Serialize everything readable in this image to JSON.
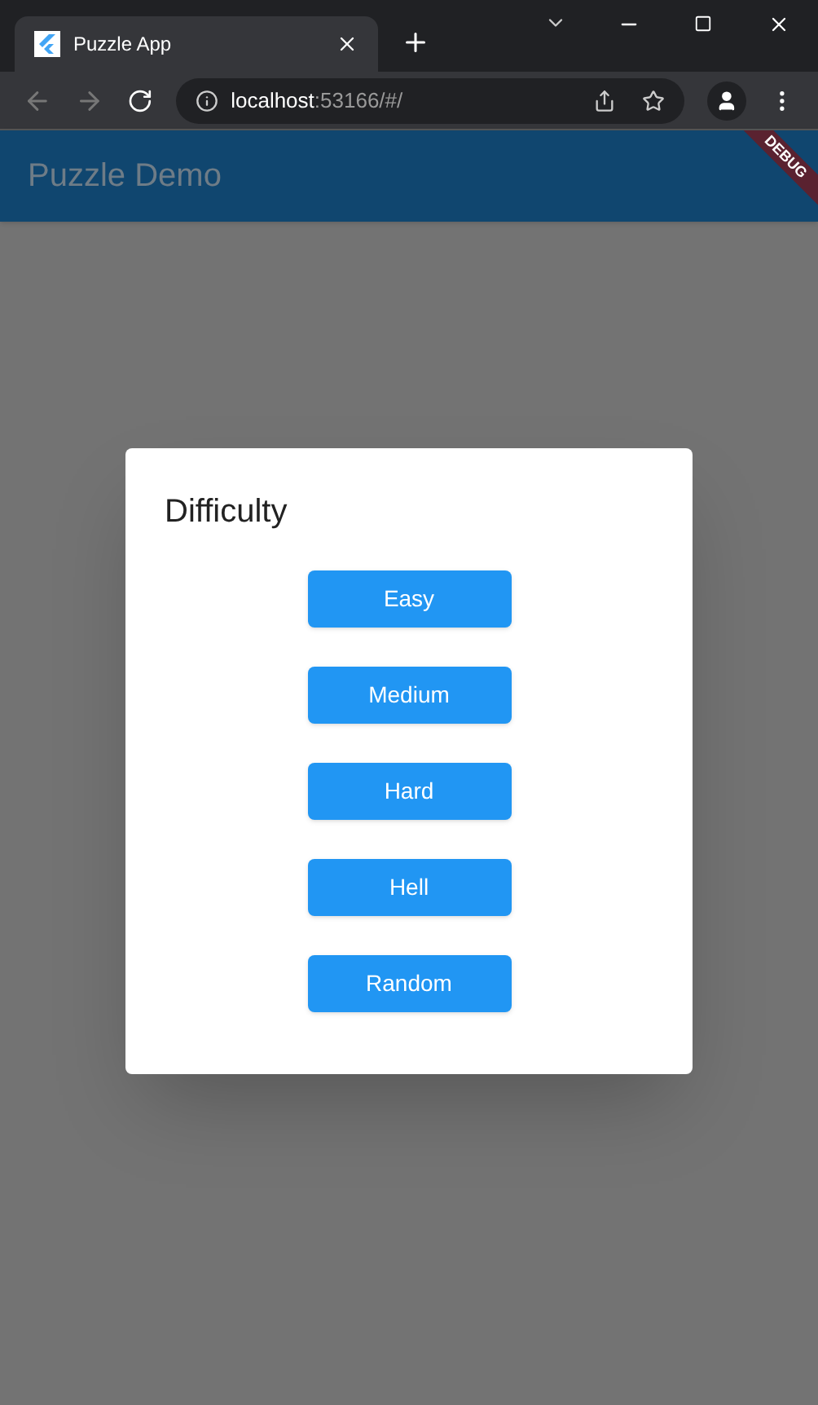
{
  "browser": {
    "tab_title": "Puzzle App",
    "url_host": "localhost",
    "url_rest": ":53166/#/"
  },
  "app_bar": {
    "title": "Puzzle Demo",
    "debug_banner": "DEBUG"
  },
  "dialog": {
    "title": "Difficulty",
    "buttons": [
      "Easy",
      "Medium",
      "Hard",
      "Hell",
      "Random"
    ]
  }
}
